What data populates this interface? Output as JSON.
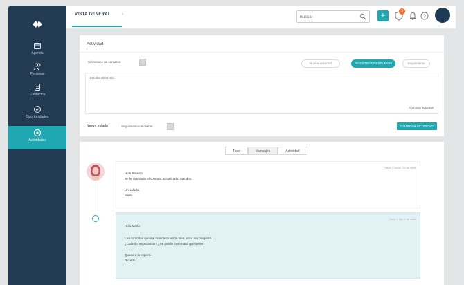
{
  "sidebar": {
    "items": [
      {
        "label": "Agenda",
        "icon": "calendar-icon"
      },
      {
        "label": "Personas",
        "icon": "people-icon"
      },
      {
        "label": "Contactos",
        "icon": "contacts-icon"
      },
      {
        "label": "Oportunidades",
        "icon": "check-circle-icon"
      },
      {
        "label": "Actividades",
        "icon": "activity-icon",
        "active": true
      }
    ]
  },
  "topbar": {
    "tab_label": "VISTA GENERAL",
    "search_placeholder": "Buscar",
    "add_label": "+",
    "badge_count": "3"
  },
  "activity": {
    "title": "Actividad",
    "contact_select": "Seleccione un contacto",
    "pills": [
      {
        "label": "Nueva actividad",
        "on": false
      },
      {
        "label": "REGISTRAR RESPUESTA",
        "on": true
      },
      {
        "label": "Seguimiento",
        "on": false
      }
    ],
    "note_placeholder": "Escriba una nota...",
    "attach_label": "Archivos adjuntos",
    "next_label": "Nuevo estado",
    "next_type": "Seguimiento de cliente",
    "save_label": "GUARDAR ACTIVIDAD"
  },
  "feed": {
    "filters": [
      {
        "label": "Todo",
        "selected": false
      },
      {
        "label": "Mensajes",
        "selected": true
      },
      {
        "label": "Actividad",
        "selected": false
      }
    ],
    "message1": {
      "date": "Hace 2 horas, 10 de abril",
      "greeting": "Hola Ricardo,",
      "line1": "Te he mandado el contrato actualizado. Saludos.",
      "sign1": "Un saludo,",
      "sign2": "María"
    },
    "message2": {
      "date": "Hace 1 día, 9 de abril",
      "greeting": "Hola María",
      "line1": "Los contratos que me mandaste están bien, solo una pregunta.",
      "line2": "¿Cuándo empezamos? ¿Se puede la semana que viene?",
      "sign1": "Quedo a la espera.",
      "sign2": "Ricardo"
    }
  },
  "colors": {
    "accent": "#1fa7b2",
    "sidebar": "#233b52",
    "badge": "#f06a28",
    "msg_bg": "#e2f1f3"
  }
}
